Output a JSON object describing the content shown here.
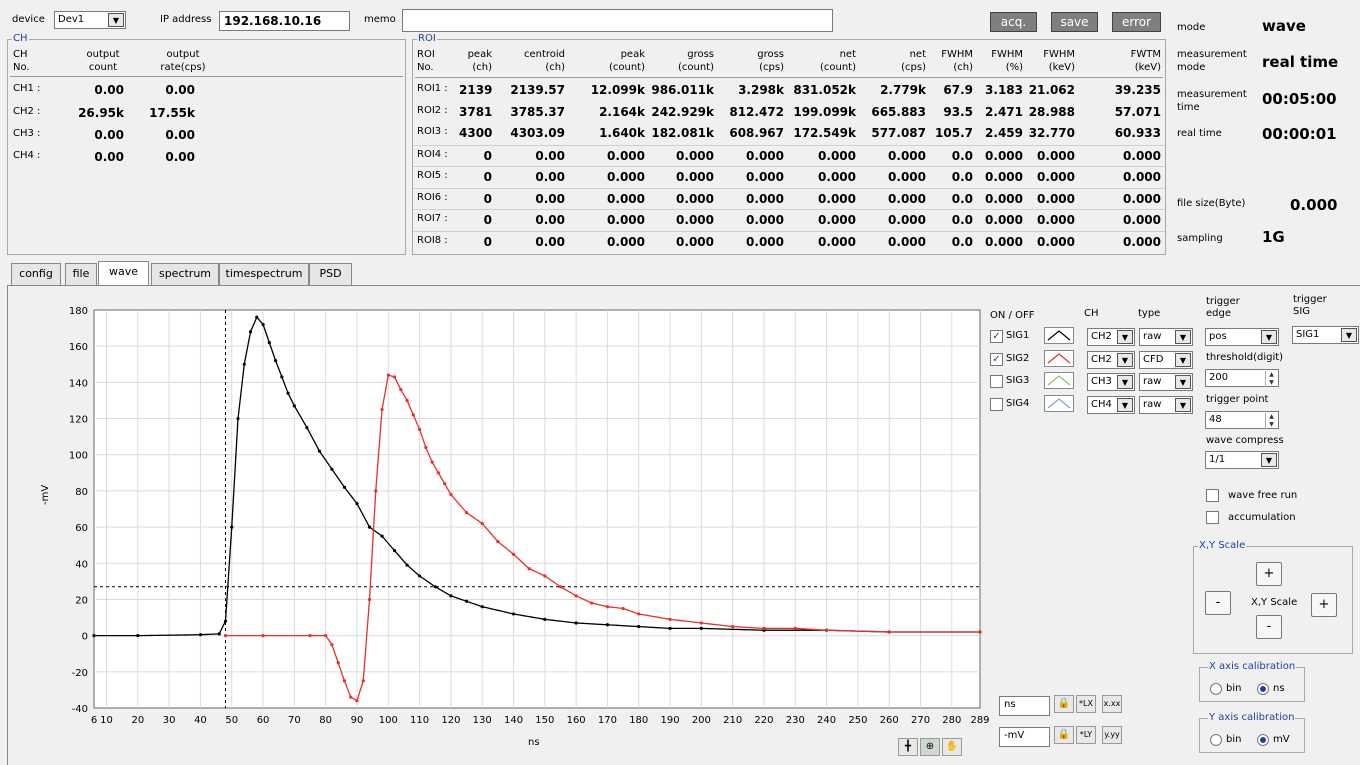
{
  "device": {
    "label": "device",
    "value": "Dev1"
  },
  "ip": {
    "label": "IP address",
    "value": "192.168.10.16"
  },
  "memo": {
    "label": "memo",
    "value": ""
  },
  "buttons": {
    "acq": "acq.",
    "save": "save",
    "error": "error"
  },
  "status": {
    "mode_label": "mode",
    "mode_value": "wave",
    "meas_mode_label": "measurement\nmode",
    "meas_mode_value": "real time",
    "meas_time_label": "measurement\ntime",
    "meas_time_value": "00:05:00",
    "real_time_label": "real time",
    "real_time_value": "00:00:01",
    "file_size_label": "file size(Byte)",
    "file_size_value": "0.000",
    "sampling_label": "sampling",
    "sampling_value": "1G"
  },
  "ch_panel": {
    "legend": "CH",
    "headers": [
      "CH\nNo.",
      "output\ncount",
      "output\nrate(cps)"
    ],
    "rows": [
      {
        "name": "CH1 :",
        "count": "0.00",
        "rate": "0.00"
      },
      {
        "name": "CH2 :",
        "count": "26.95k",
        "rate": "17.55k"
      },
      {
        "name": "CH3 :",
        "count": "0.00",
        "rate": "0.00"
      },
      {
        "name": "CH4 :",
        "count": "0.00",
        "rate": "0.00"
      }
    ]
  },
  "roi_panel": {
    "legend": "ROI",
    "headers": [
      "ROI\nNo.",
      "peak\n(ch)",
      "centroid\n(ch)",
      "peak\n(count)",
      "gross\n(count)",
      "gross\n(cps)",
      "net\n(count)",
      "net\n(cps)",
      "FWHM\n(ch)",
      "FWHM\n(%)",
      "FWHM\n(keV)",
      "FWTM\n(keV)"
    ],
    "rows": [
      [
        "ROI1 :",
        "2139",
        "2139.57",
        "12.099k",
        "986.011k",
        "3.298k",
        "831.052k",
        "2.779k",
        "67.9",
        "3.183",
        "21.062",
        "39.235"
      ],
      [
        "ROI2 :",
        "3781",
        "3785.37",
        "2.164k",
        "242.929k",
        "812.472",
        "199.099k",
        "665.883",
        "93.5",
        "2.471",
        "28.988",
        "57.071"
      ],
      [
        "ROI3 :",
        "4300",
        "4303.09",
        "1.640k",
        "182.081k",
        "608.967",
        "172.549k",
        "577.087",
        "105.7",
        "2.459",
        "32.770",
        "60.933"
      ],
      [
        "ROI4 :",
        "0",
        "0.00",
        "0.000",
        "0.000",
        "0.000",
        "0.000",
        "0.000",
        "0.0",
        "0.000",
        "0.000",
        "0.000"
      ],
      [
        "ROI5 :",
        "0",
        "0.00",
        "0.000",
        "0.000",
        "0.000",
        "0.000",
        "0.000",
        "0.0",
        "0.000",
        "0.000",
        "0.000"
      ],
      [
        "ROI6 :",
        "0",
        "0.00",
        "0.000",
        "0.000",
        "0.000",
        "0.000",
        "0.000",
        "0.0",
        "0.000",
        "0.000",
        "0.000"
      ],
      [
        "ROI7 :",
        "0",
        "0.00",
        "0.000",
        "0.000",
        "0.000",
        "0.000",
        "0.000",
        "0.0",
        "0.000",
        "0.000",
        "0.000"
      ],
      [
        "ROI8 :",
        "0",
        "0.00",
        "0.000",
        "0.000",
        "0.000",
        "0.000",
        "0.000",
        "0.0",
        "0.000",
        "0.000",
        "0.000"
      ]
    ]
  },
  "tabs": [
    "config",
    "file",
    "wave",
    "spectrum",
    "timespectrum",
    "PSD"
  ],
  "active_tab": "wave",
  "signals": {
    "on_off_label": "ON / OFF",
    "ch_label": "CH",
    "type_label": "type",
    "items": [
      {
        "name": "SIG1",
        "on": true,
        "ch": "CH2",
        "type": "raw",
        "color": "#000000"
      },
      {
        "name": "SIG2",
        "on": true,
        "ch": "CH2",
        "type": "CFD",
        "color": "#e8302a"
      },
      {
        "name": "SIG3",
        "on": false,
        "ch": "CH3",
        "type": "raw",
        "color": "#8cbf6e"
      },
      {
        "name": "SIG4",
        "on": false,
        "ch": "CH4",
        "type": "raw",
        "color": "#7aa0d8"
      }
    ]
  },
  "trigger": {
    "edge_label": "trigger\nedge",
    "edge_value": "pos",
    "sig_label": "trigger\nSIG",
    "sig_value": "SIG1",
    "threshold_label": "threshold(digit)",
    "threshold_value": "200",
    "point_label": "trigger point",
    "point_value": "48",
    "compress_label": "wave compress",
    "compress_value": "1/1"
  },
  "options": {
    "free_run": "wave free run",
    "accumulation": "accumulation"
  },
  "xy_scale": {
    "legend": "X,Y Scale",
    "center": "X,Y Scale",
    "plus": "+",
    "minus": "-"
  },
  "x_cal": {
    "legend": "X axis calibration",
    "opt1": "bin",
    "opt2": "ns",
    "selected": "ns"
  },
  "y_cal": {
    "legend": "Y axis calibration",
    "opt1": "bin",
    "opt2": "mV",
    "selected": "mV"
  },
  "axis_units": {
    "x": "ns",
    "y": "-mV"
  },
  "chart_data": {
    "type": "line",
    "xlabel": "ns",
    "ylabel": "-mV",
    "xlim": [
      6,
      289
    ],
    "ylim": [
      -40,
      180
    ],
    "xticks": [
      6,
      10,
      20,
      30,
      40,
      50,
      60,
      70,
      80,
      90,
      100,
      110,
      120,
      130,
      140,
      150,
      160,
      170,
      180,
      190,
      200,
      210,
      220,
      230,
      240,
      250,
      260,
      270,
      280,
      289
    ],
    "yticks": [
      -40,
      -20,
      0,
      20,
      40,
      60,
      80,
      100,
      120,
      140,
      160,
      180
    ],
    "grid": true,
    "trigger_x": 48,
    "threshold_y": 27,
    "series": [
      {
        "name": "SIG1",
        "color": "#000000",
        "points": [
          [
            6,
            0
          ],
          [
            20,
            0
          ],
          [
            40,
            0.5
          ],
          [
            46,
            1
          ],
          [
            48,
            8
          ],
          [
            50,
            60
          ],
          [
            52,
            120
          ],
          [
            54,
            150
          ],
          [
            56,
            168
          ],
          [
            58,
            176
          ],
          [
            60,
            172
          ],
          [
            62,
            162
          ],
          [
            64,
            152
          ],
          [
            66,
            143
          ],
          [
            68,
            134
          ],
          [
            70,
            127
          ],
          [
            74,
            115
          ],
          [
            78,
            102
          ],
          [
            82,
            92
          ],
          [
            86,
            82
          ],
          [
            90,
            73
          ],
          [
            94,
            60
          ],
          [
            98,
            55
          ],
          [
            102,
            47
          ],
          [
            106,
            39
          ],
          [
            110,
            33
          ],
          [
            115,
            27
          ],
          [
            120,
            22
          ],
          [
            125,
            19
          ],
          [
            130,
            16
          ],
          [
            140,
            12
          ],
          [
            150,
            9
          ],
          [
            160,
            7
          ],
          [
            170,
            6
          ],
          [
            180,
            5
          ],
          [
            190,
            4
          ],
          [
            200,
            4
          ],
          [
            220,
            3
          ],
          [
            240,
            3
          ],
          [
            260,
            2
          ],
          [
            289,
            2
          ]
        ]
      },
      {
        "name": "SIG2",
        "color": "#e8302a",
        "points": [
          [
            48,
            0
          ],
          [
            60,
            0
          ],
          [
            75,
            0
          ],
          [
            80,
            0
          ],
          [
            82,
            -5
          ],
          [
            84,
            -15
          ],
          [
            86,
            -25
          ],
          [
            88,
            -34
          ],
          [
            90,
            -36
          ],
          [
            92,
            -25
          ],
          [
            94,
            20
          ],
          [
            96,
            80
          ],
          [
            98,
            125
          ],
          [
            100,
            144
          ],
          [
            102,
            143
          ],
          [
            104,
            136
          ],
          [
            106,
            130
          ],
          [
            108,
            122
          ],
          [
            110,
            114
          ],
          [
            112,
            104
          ],
          [
            114,
            96
          ],
          [
            116,
            90
          ],
          [
            118,
            84
          ],
          [
            120,
            78
          ],
          [
            125,
            68
          ],
          [
            130,
            62
          ],
          [
            135,
            52
          ],
          [
            140,
            45
          ],
          [
            145,
            37
          ],
          [
            150,
            33
          ],
          [
            155,
            27
          ],
          [
            160,
            22
          ],
          [
            165,
            18
          ],
          [
            170,
            16
          ],
          [
            175,
            15
          ],
          [
            180,
            12
          ],
          [
            190,
            9
          ],
          [
            200,
            7
          ],
          [
            210,
            5
          ],
          [
            220,
            4
          ],
          [
            230,
            4
          ],
          [
            240,
            3
          ],
          [
            260,
            2
          ],
          [
            289,
            2
          ]
        ]
      }
    ]
  }
}
